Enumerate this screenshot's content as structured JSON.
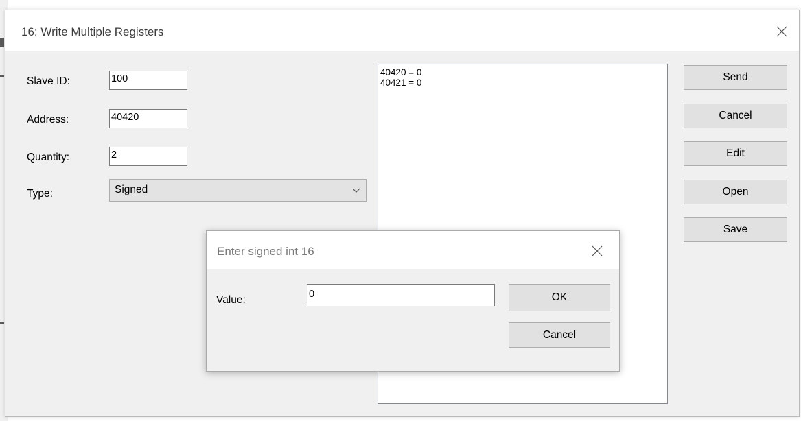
{
  "main_dialog": {
    "title": "16: Write Multiple Registers",
    "fields": {
      "slave_id": {
        "label": "Slave ID:",
        "value": "100"
      },
      "address": {
        "label": "Address:",
        "value": "40420"
      },
      "quantity": {
        "label": "Quantity:",
        "value": "2"
      },
      "type": {
        "label": "Type:",
        "value": "Signed"
      }
    },
    "registers": [
      "40420 = 0",
      "40421 = 0"
    ],
    "buttons": {
      "send": "Send",
      "cancel": "Cancel",
      "edit": "Edit",
      "open": "Open",
      "save": "Save"
    }
  },
  "value_dialog": {
    "title": "Enter signed int 16",
    "value_label": "Value:",
    "value": "0",
    "ok": "OK",
    "cancel": "Cancel"
  }
}
